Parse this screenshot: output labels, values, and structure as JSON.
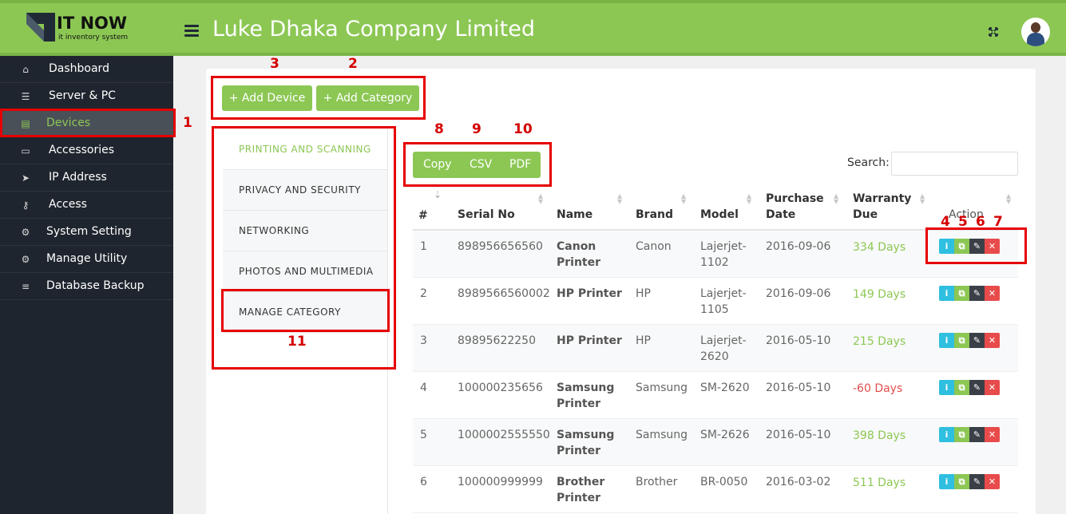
{
  "brand": {
    "title": "IT NOW",
    "subtitle": "it inventory system"
  },
  "header": {
    "company": "Luke Dhaka Company Limited"
  },
  "sidebar": {
    "items": [
      {
        "label": "Dashboard",
        "icon": "home-icon"
      },
      {
        "label": "Server & PC",
        "icon": "server-icon"
      },
      {
        "label": "Devices",
        "icon": "printer-icon",
        "active": true
      },
      {
        "label": "Accessories",
        "icon": "monitor-icon"
      },
      {
        "label": "IP Address",
        "icon": "location-arrow-icon"
      },
      {
        "label": "Access",
        "icon": "key-icon"
      },
      {
        "label": "System Setting",
        "icon": "gears-icon"
      },
      {
        "label": "Manage Utility",
        "icon": "gears-icon"
      },
      {
        "label": "Database Backup",
        "icon": "database-icon"
      }
    ]
  },
  "toolbar": {
    "add_device": "+ Add Device",
    "add_category": "+ Add Category"
  },
  "categories": [
    {
      "label": "PRINTING AND SCANNING",
      "active": true
    },
    {
      "label": "PRIVACY AND SECURITY"
    },
    {
      "label": "NETWORKING"
    },
    {
      "label": "PHOTOS AND MULTIMEDIA"
    },
    {
      "label": "MANAGE CATEGORY"
    }
  ],
  "export": {
    "copy": "Copy",
    "csv": "CSV",
    "pdf": "PDF"
  },
  "search": {
    "label": "Search:"
  },
  "table": {
    "headers": [
      "#",
      "Serial No",
      "Name",
      "Brand",
      "Model",
      "Purchase",
      "Date",
      "Warranty",
      "Due",
      "Action"
    ],
    "rows": [
      {
        "num": "1",
        "serial": "898956656560",
        "name1": "Canon",
        "name2": "Printer",
        "brand": "Canon",
        "model1": "Lajerjet-",
        "model2": "1102",
        "date": "2016-09-06",
        "due": "334 Days",
        "due_status": "ok"
      },
      {
        "num": "2",
        "serial": "8989566560002",
        "name1": "HP Printer",
        "name2": "",
        "brand": "HP",
        "model1": "Lajerjet-",
        "model2": "1105",
        "date": "2016-09-06",
        "due": "149 Days",
        "due_status": "ok"
      },
      {
        "num": "3",
        "serial": "89895622250",
        "name1": "HP Printer",
        "name2": "",
        "brand": "HP",
        "model1": "Lajerjet-",
        "model2": "2620",
        "date": "2016-05-10",
        "due": "215 Days",
        "due_status": "ok"
      },
      {
        "num": "4",
        "serial": "100000235656",
        "name1": "Samsung",
        "name2": "Printer",
        "brand": "Samsung",
        "model1": "SM-2620",
        "model2": "",
        "date": "2016-05-10",
        "due": "-60 Days",
        "due_status": "bad"
      },
      {
        "num": "5",
        "serial": "1000002555550",
        "name1": "Samsung",
        "name2": "Printer",
        "brand": "Samsung",
        "model1": "SM-2626",
        "model2": "",
        "date": "2016-05-10",
        "due": "398 Days",
        "due_status": "ok"
      },
      {
        "num": "6",
        "serial": "100000999999",
        "name1": "Brother",
        "name2": "Printer",
        "brand": "Brother",
        "model1": "BR-0050",
        "model2": "",
        "date": "2016-03-02",
        "due": "511 Days",
        "due_status": "ok"
      }
    ]
  },
  "annotations": [
    "1",
    "2",
    "3",
    "4",
    "5",
    "6",
    "7",
    "8",
    "9",
    "10",
    "11"
  ],
  "colors": {
    "accent": "#8cc754",
    "sidebar": "#1f252e",
    "danger": "#e84b4b",
    "info": "#2fbfe0",
    "annotation": "#e60000"
  }
}
